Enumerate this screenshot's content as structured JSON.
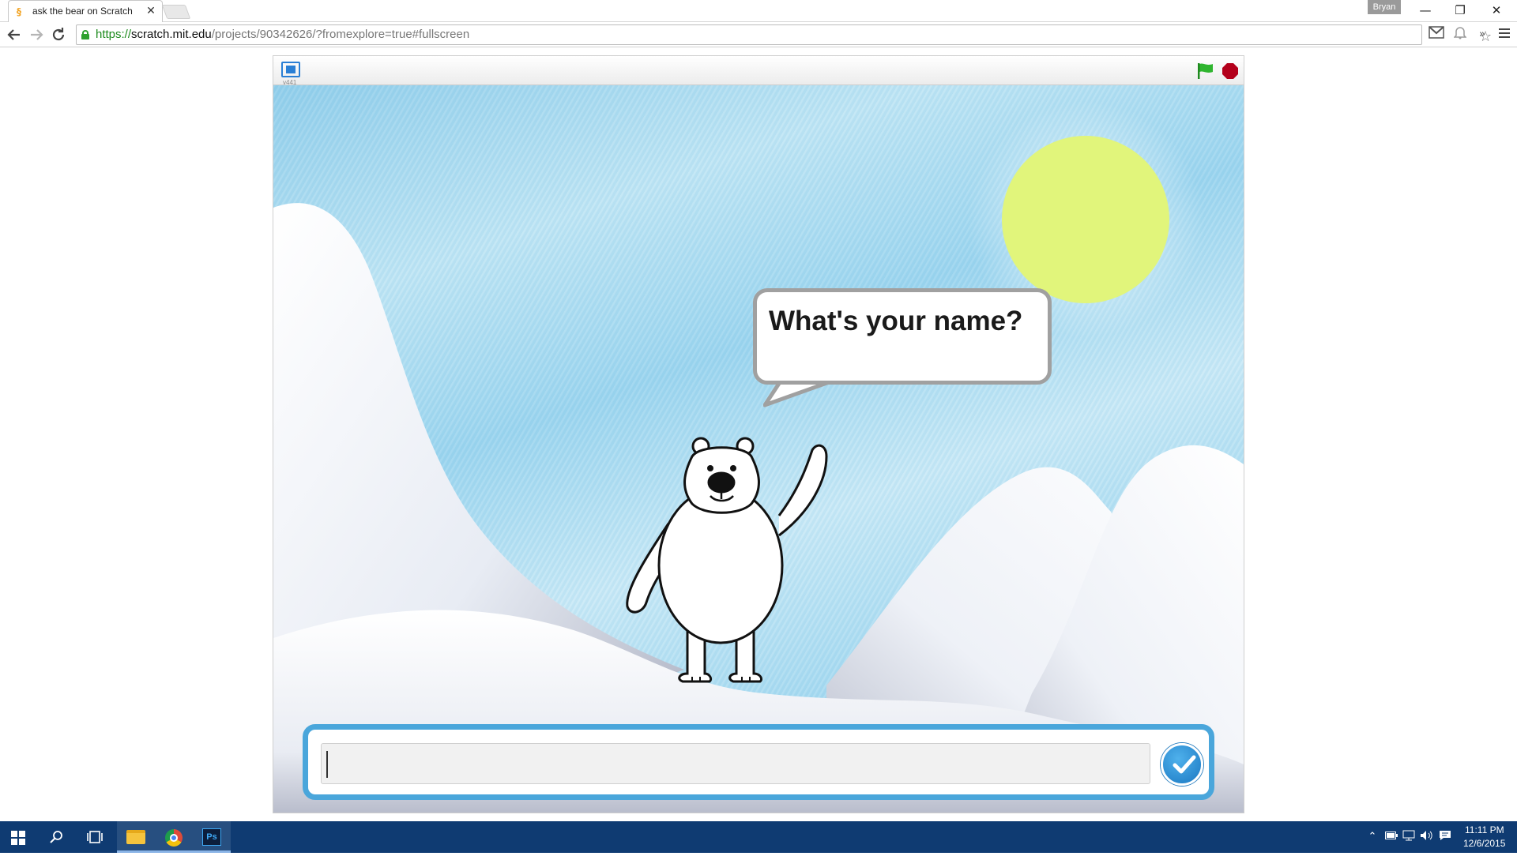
{
  "browser": {
    "tab_title": "ask the bear on Scratch",
    "tab_close": "✕",
    "user_name": "Bryan",
    "url_scheme": "https://",
    "url_host": "scratch.mit.edu",
    "url_path": "/projects/90342626/?fromexplore=true#fullscreen",
    "window_controls": [
      "—",
      "❐",
      "✕"
    ]
  },
  "player": {
    "version": "v441",
    "icons": {
      "fullscreen": "fullscreen-toggle-icon",
      "go": "green-flag-icon",
      "stop": "stop-sign-icon"
    },
    "speech_text": "What's your name?",
    "ask_value": "",
    "accent_color": "#4aa6db",
    "flag_color": "#2fb52f",
    "stop_color": "#b3001b"
  },
  "taskbar": {
    "time": "11:11 PM",
    "date": "12/6/2015",
    "ps_label": "Ps",
    "color": "#0f3b72"
  }
}
